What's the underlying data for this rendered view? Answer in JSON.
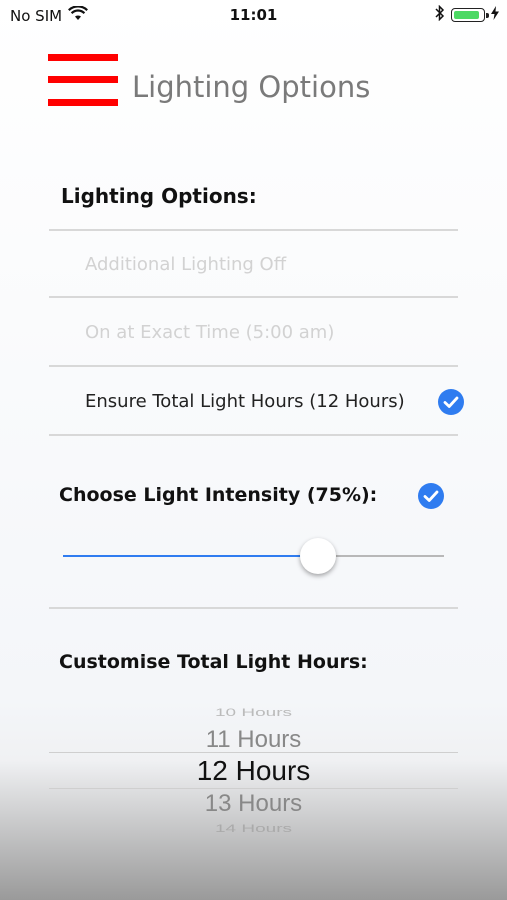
{
  "status_bar": {
    "carrier": "No SIM",
    "time": "11:01",
    "battery_level": 0.9,
    "battery_color": "#4cd964"
  },
  "header": {
    "title": "Lighting Options",
    "menu_color": "#ff0000"
  },
  "lighting": {
    "title": "Lighting Options:",
    "options": [
      {
        "label": "Additional Lighting Off",
        "enabled": false,
        "checked": false
      },
      {
        "label": "On at Exact Time (5:00 am)",
        "enabled": false,
        "checked": false
      },
      {
        "label": "Ensure Total Light Hours (12 Hours)",
        "enabled": true,
        "checked": true
      }
    ]
  },
  "intensity": {
    "title": "Choose Light Intensity (75%):",
    "checked": true,
    "slider_value": 0.67
  },
  "hours": {
    "title": "Customise Total Light Hours:",
    "picker": [
      "10 Hours",
      "11 Hours",
      "12 Hours",
      "13 Hours",
      "14 Hours"
    ],
    "selected": "12 Hours"
  },
  "accent_color": "#2f7cf0"
}
